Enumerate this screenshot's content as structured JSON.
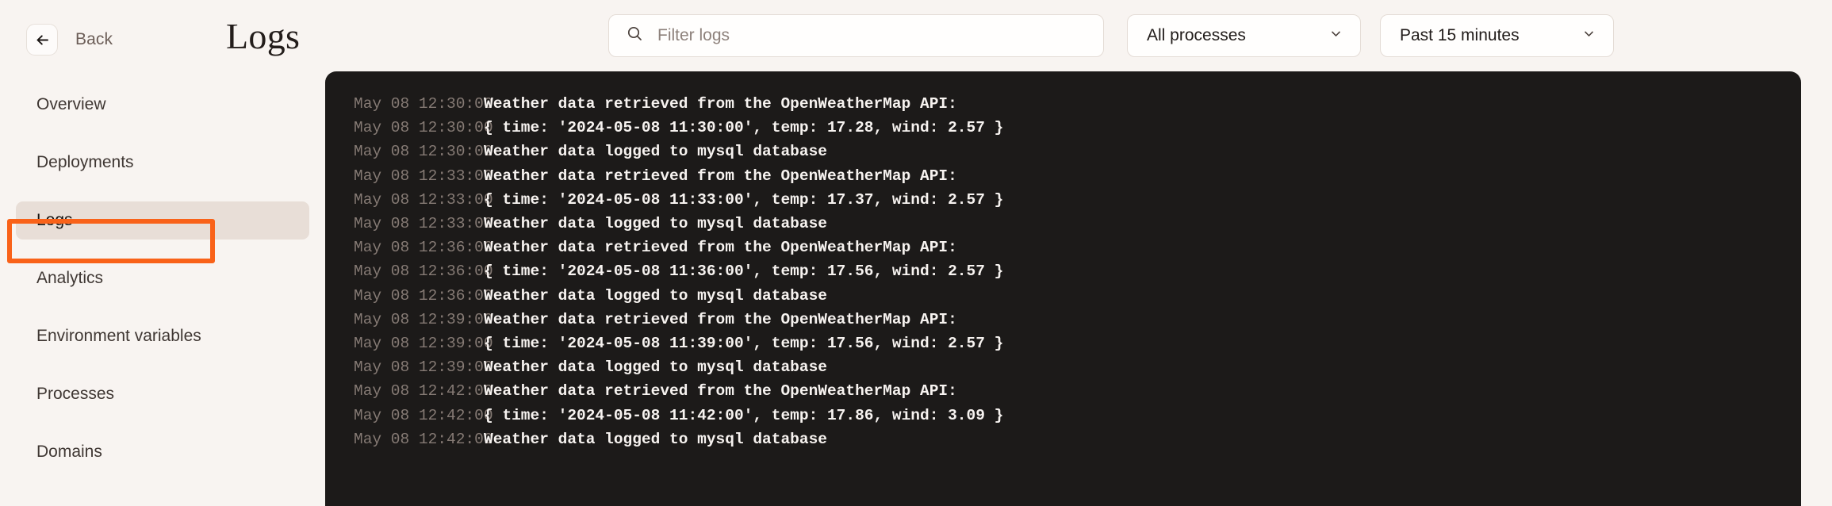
{
  "sidebar": {
    "back": {
      "label": "Back",
      "icon": "arrow-left-icon"
    },
    "items": [
      {
        "label": "Overview",
        "active": false
      },
      {
        "label": "Deployments",
        "active": false
      },
      {
        "label": "Logs",
        "active": true
      },
      {
        "label": "Analytics",
        "active": false
      },
      {
        "label": "Environment variables",
        "active": false
      },
      {
        "label": "Processes",
        "active": false
      },
      {
        "label": "Domains",
        "active": false
      }
    ]
  },
  "header": {
    "title": "Logs",
    "search": {
      "icon": "search-icon",
      "placeholder": "Filter logs",
      "value": ""
    },
    "process_filter": {
      "selected": "All processes",
      "icon": "chevron-down-icon"
    },
    "time_filter": {
      "selected": "Past 15 minutes",
      "icon": "chevron-down-icon"
    }
  },
  "annotation": {
    "color": "#f96219",
    "target": "Logs"
  },
  "colors": {
    "page_background": "#f8f4f1",
    "log_panel_background": "#1c1a19",
    "log_timestamp": "#857a74",
    "log_message": "#f7f3f0",
    "active_nav_background": "#e8ded7",
    "annotation_orange": "#f96219"
  },
  "logs": [
    {
      "time": "May 08 12:30:00",
      "message": "Weather data retrieved from the OpenWeatherMap API:"
    },
    {
      "time": "May 08 12:30:00",
      "message": "{ time: '2024-05-08 11:30:00', temp: 17.28, wind: 2.57 }"
    },
    {
      "time": "May 08 12:30:00",
      "message": "Weather data logged to mysql database"
    },
    {
      "time": "May 08 12:33:00",
      "message": "Weather data retrieved from the OpenWeatherMap API:"
    },
    {
      "time": "May 08 12:33:00",
      "message": "{ time: '2024-05-08 11:33:00', temp: 17.37, wind: 2.57 }"
    },
    {
      "time": "May 08 12:33:00",
      "message": "Weather data logged to mysql database"
    },
    {
      "time": "May 08 12:36:00",
      "message": "Weather data retrieved from the OpenWeatherMap API:"
    },
    {
      "time": "May 08 12:36:00",
      "message": "{ time: '2024-05-08 11:36:00', temp: 17.56, wind: 2.57 }"
    },
    {
      "time": "May 08 12:36:00",
      "message": "Weather data logged to mysql database"
    },
    {
      "time": "May 08 12:39:00",
      "message": "Weather data retrieved from the OpenWeatherMap API:"
    },
    {
      "time": "May 08 12:39:00",
      "message": "{ time: '2024-05-08 11:39:00', temp: 17.56, wind: 2.57 }"
    },
    {
      "time": "May 08 12:39:00",
      "message": "Weather data logged to mysql database"
    },
    {
      "time": "May 08 12:42:00",
      "message": "Weather data retrieved from the OpenWeatherMap API:"
    },
    {
      "time": "May 08 12:42:00",
      "message": "{ time: '2024-05-08 11:42:00', temp: 17.86, wind: 3.09 }"
    },
    {
      "time": "May 08 12:42:00",
      "message": "Weather data logged to mysql database"
    }
  ]
}
